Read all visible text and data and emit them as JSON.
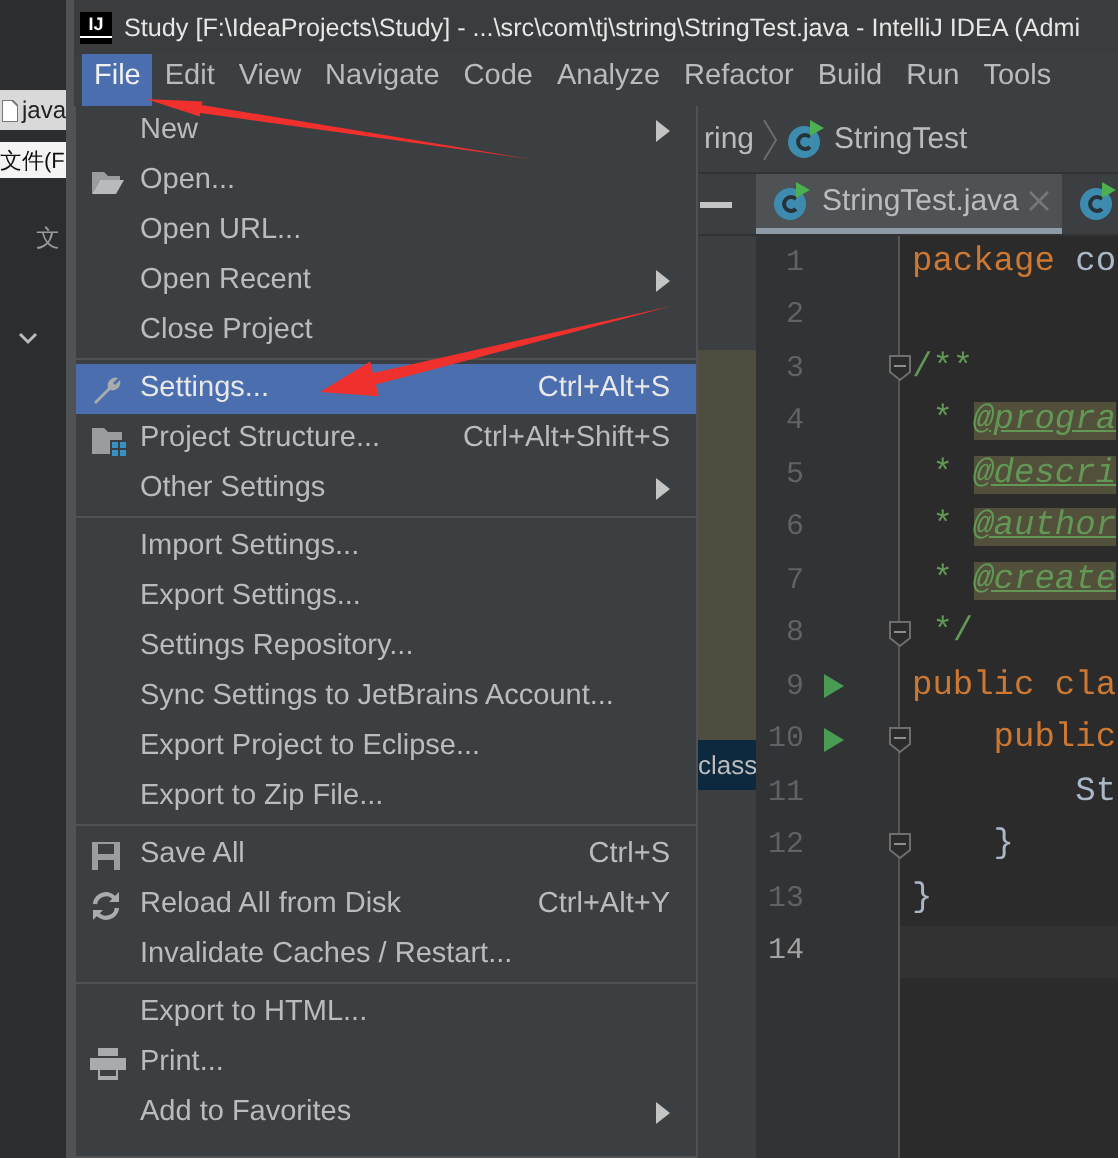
{
  "background_window": {
    "tab": "java",
    "menu": "文件(F",
    "label": "文"
  },
  "window": {
    "logo": "IJ",
    "title": "Study [F:\\IdeaProjects\\Study] - ...\\src\\com\\tj\\string\\StringTest.java - IntelliJ IDEA (Admi"
  },
  "menu_bar": [
    {
      "label": "File",
      "selected": true
    },
    {
      "label": "Edit",
      "selected": false
    },
    {
      "label": "View",
      "selected": false
    },
    {
      "label": "Navigate",
      "selected": false
    },
    {
      "label": "Code",
      "selected": false
    },
    {
      "label": "Analyze",
      "selected": false
    },
    {
      "label": "Refactor",
      "selected": false
    },
    {
      "label": "Build",
      "selected": false
    },
    {
      "label": "Run",
      "selected": false
    },
    {
      "label": "Tools",
      "selected": false
    }
  ],
  "navigation_bar": {
    "path_tail": "ring",
    "class_name": "StringTest"
  },
  "editor_tabs": [
    {
      "label": "StringTest.java",
      "selected": true
    },
    {
      "selected": false
    }
  ],
  "project_pane": {
    "highlighted_text": "class"
  },
  "file_menu": {
    "groups": [
      [
        {
          "label": "New",
          "submenu": true,
          "selected": false
        },
        {
          "label": "Open...",
          "kind": "folder",
          "submenu": false,
          "selected": false
        },
        {
          "label": "Open URL...",
          "submenu": false,
          "selected": false
        },
        {
          "label": "Open Recent",
          "submenu": true,
          "selected": false
        },
        {
          "label": "Close Project",
          "submenu": false,
          "selected": false
        }
      ],
      [
        {
          "label": "Settings...",
          "kind": "wrench",
          "shortcut": "Ctrl+Alt+S",
          "submenu": false,
          "selected": true
        },
        {
          "label": "Project Structure...",
          "kind": "structure",
          "shortcut": "Ctrl+Alt+Shift+S",
          "submenu": false,
          "selected": false
        },
        {
          "label": "Other Settings",
          "submenu": true,
          "selected": false
        }
      ],
      [
        {
          "label": "Import Settings...",
          "submenu": false,
          "selected": false
        },
        {
          "label": "Export Settings...",
          "submenu": false,
          "selected": false
        },
        {
          "label": "Settings Repository...",
          "submenu": false,
          "selected": false
        },
        {
          "label": "Sync Settings to JetBrains Account...",
          "submenu": false,
          "selected": false
        },
        {
          "label": "Export Project to Eclipse...",
          "submenu": false,
          "selected": false
        },
        {
          "label": "Export to Zip File...",
          "submenu": false,
          "selected": false
        }
      ],
      [
        {
          "label": "Save All",
          "kind": "save",
          "shortcut": "Ctrl+S",
          "submenu": false,
          "selected": false
        },
        {
          "label": "Reload All from Disk",
          "kind": "reload",
          "shortcut": "Ctrl+Alt+Y",
          "submenu": false,
          "selected": false
        },
        {
          "label": "Invalidate Caches / Restart...",
          "submenu": false,
          "selected": false
        }
      ],
      [
        {
          "label": "Export to HTML...",
          "submenu": false,
          "selected": false
        },
        {
          "label": "Print...",
          "kind": "printer",
          "submenu": false,
          "selected": false
        },
        {
          "label": "Add to Favorites",
          "submenu": true,
          "selected": false
        }
      ]
    ]
  },
  "code_lines": [
    {
      "number": "1",
      "tokens": [
        {
          "text": "package",
          "kind": "keyword"
        },
        {
          "text": " co",
          "kind": "plain"
        }
      ],
      "run": false,
      "fold": false,
      "current": false
    },
    {
      "number": "2",
      "run": false,
      "fold": false,
      "current": false
    },
    {
      "number": "3",
      "tokens": [
        {
          "text": "/**",
          "kind": "comment"
        }
      ],
      "run": false,
      "fold": true,
      "current": false
    },
    {
      "number": "4",
      "tokens": [
        {
          "text": " * ",
          "kind": "comment"
        },
        {
          "text": "@progra",
          "kind": "tag"
        }
      ],
      "run": false,
      "fold": false,
      "current": false
    },
    {
      "number": "5",
      "tokens": [
        {
          "text": " * ",
          "kind": "comment"
        },
        {
          "text": "@descri",
          "kind": "tag"
        }
      ],
      "run": false,
      "fold": false,
      "current": false
    },
    {
      "number": "6",
      "tokens": [
        {
          "text": " * ",
          "kind": "comment"
        },
        {
          "text": "@author",
          "kind": "tag"
        }
      ],
      "run": false,
      "fold": false,
      "current": false
    },
    {
      "number": "7",
      "tokens": [
        {
          "text": " * ",
          "kind": "comment"
        },
        {
          "text": "@create",
          "kind": "tag"
        }
      ],
      "run": false,
      "fold": false,
      "current": false
    },
    {
      "number": "8",
      "tokens": [
        {
          "text": " */",
          "kind": "comment"
        }
      ],
      "run": false,
      "fold": true,
      "current": false
    },
    {
      "number": "9",
      "tokens": [
        {
          "text": "public cla",
          "kind": "keyword"
        }
      ],
      "run": true,
      "fold": false,
      "current": false
    },
    {
      "number": "10",
      "tokens": [
        {
          "text": "    public",
          "kind": "keyword"
        }
      ],
      "run": true,
      "fold": true,
      "current": false
    },
    {
      "number": "11",
      "tokens": [
        {
          "text": "        St",
          "kind": "plain"
        }
      ],
      "run": false,
      "fold": false,
      "current": false
    },
    {
      "number": "12",
      "tokens": [
        {
          "text": "    }",
          "kind": "plain"
        }
      ],
      "run": false,
      "fold": true,
      "current": false
    },
    {
      "number": "13",
      "tokens": [
        {
          "text": "}",
          "kind": "plain"
        }
      ],
      "run": false,
      "fold": false,
      "current": false
    },
    {
      "number": "14",
      "run": false,
      "fold": false,
      "current": true
    }
  ]
}
